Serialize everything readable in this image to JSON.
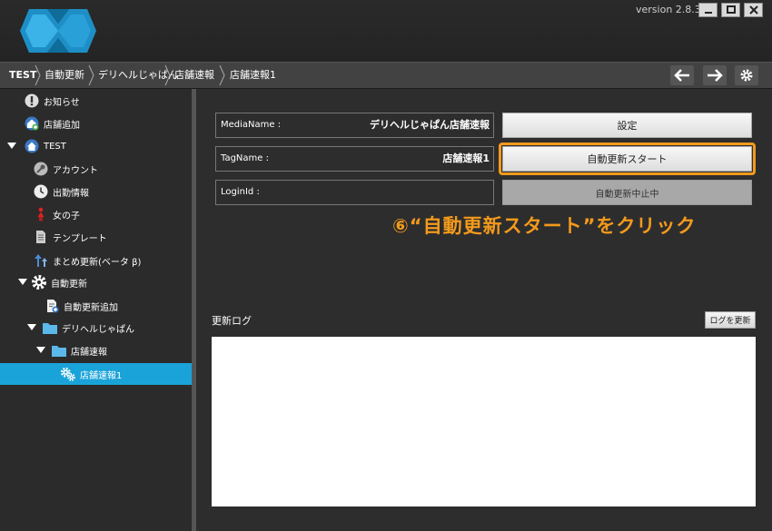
{
  "app": {
    "version": "version 2.8.3"
  },
  "breadcrumb": [
    "TEST",
    "自動更新",
    "デリヘルじゃぱん",
    "店舗速報",
    "店舗速報1"
  ],
  "sidebar": {
    "items": [
      {
        "label": "お知らせ",
        "icon": "info-icon"
      },
      {
        "label": "店舗追加",
        "icon": "add-store-icon"
      },
      {
        "label": "TEST",
        "icon": "home-icon"
      },
      {
        "label": "アカウント",
        "icon": "key-icon"
      },
      {
        "label": "出勤情報",
        "icon": "clock-icon"
      },
      {
        "label": "女の子",
        "icon": "girl-icon"
      },
      {
        "label": "テンプレート",
        "icon": "document-icon"
      },
      {
        "label": "まとめ更新(ベータ β)",
        "icon": "upload-arrows-icon"
      },
      {
        "label": "自動更新",
        "icon": "gear-icon"
      },
      {
        "label": "自動更新追加",
        "icon": "add-document-icon"
      },
      {
        "label": "デリヘルじゃぱん",
        "icon": "folder-icon"
      },
      {
        "label": "店舗速報",
        "icon": "folder-icon"
      },
      {
        "label": "店舗速報1",
        "icon": "gears-icon"
      }
    ]
  },
  "form": {
    "media_label": "MediaName :",
    "media_value": "デリヘルじゃぱん店舗速報",
    "tag_label": "TagName :",
    "tag_value": "店舗速報1",
    "login_label": "LoginId :",
    "login_value": ""
  },
  "buttons": {
    "settings": "設定",
    "start": "自動更新スタート",
    "stop": "自動更新中止中"
  },
  "annotation": "⑥“自動更新スタート”をクリック",
  "log": {
    "title": "更新ログ",
    "refresh": "ログを更新"
  },
  "colors": {
    "accent": "#f39a1c",
    "selected": "#1aa3d9",
    "logo": "#29a8e0"
  }
}
